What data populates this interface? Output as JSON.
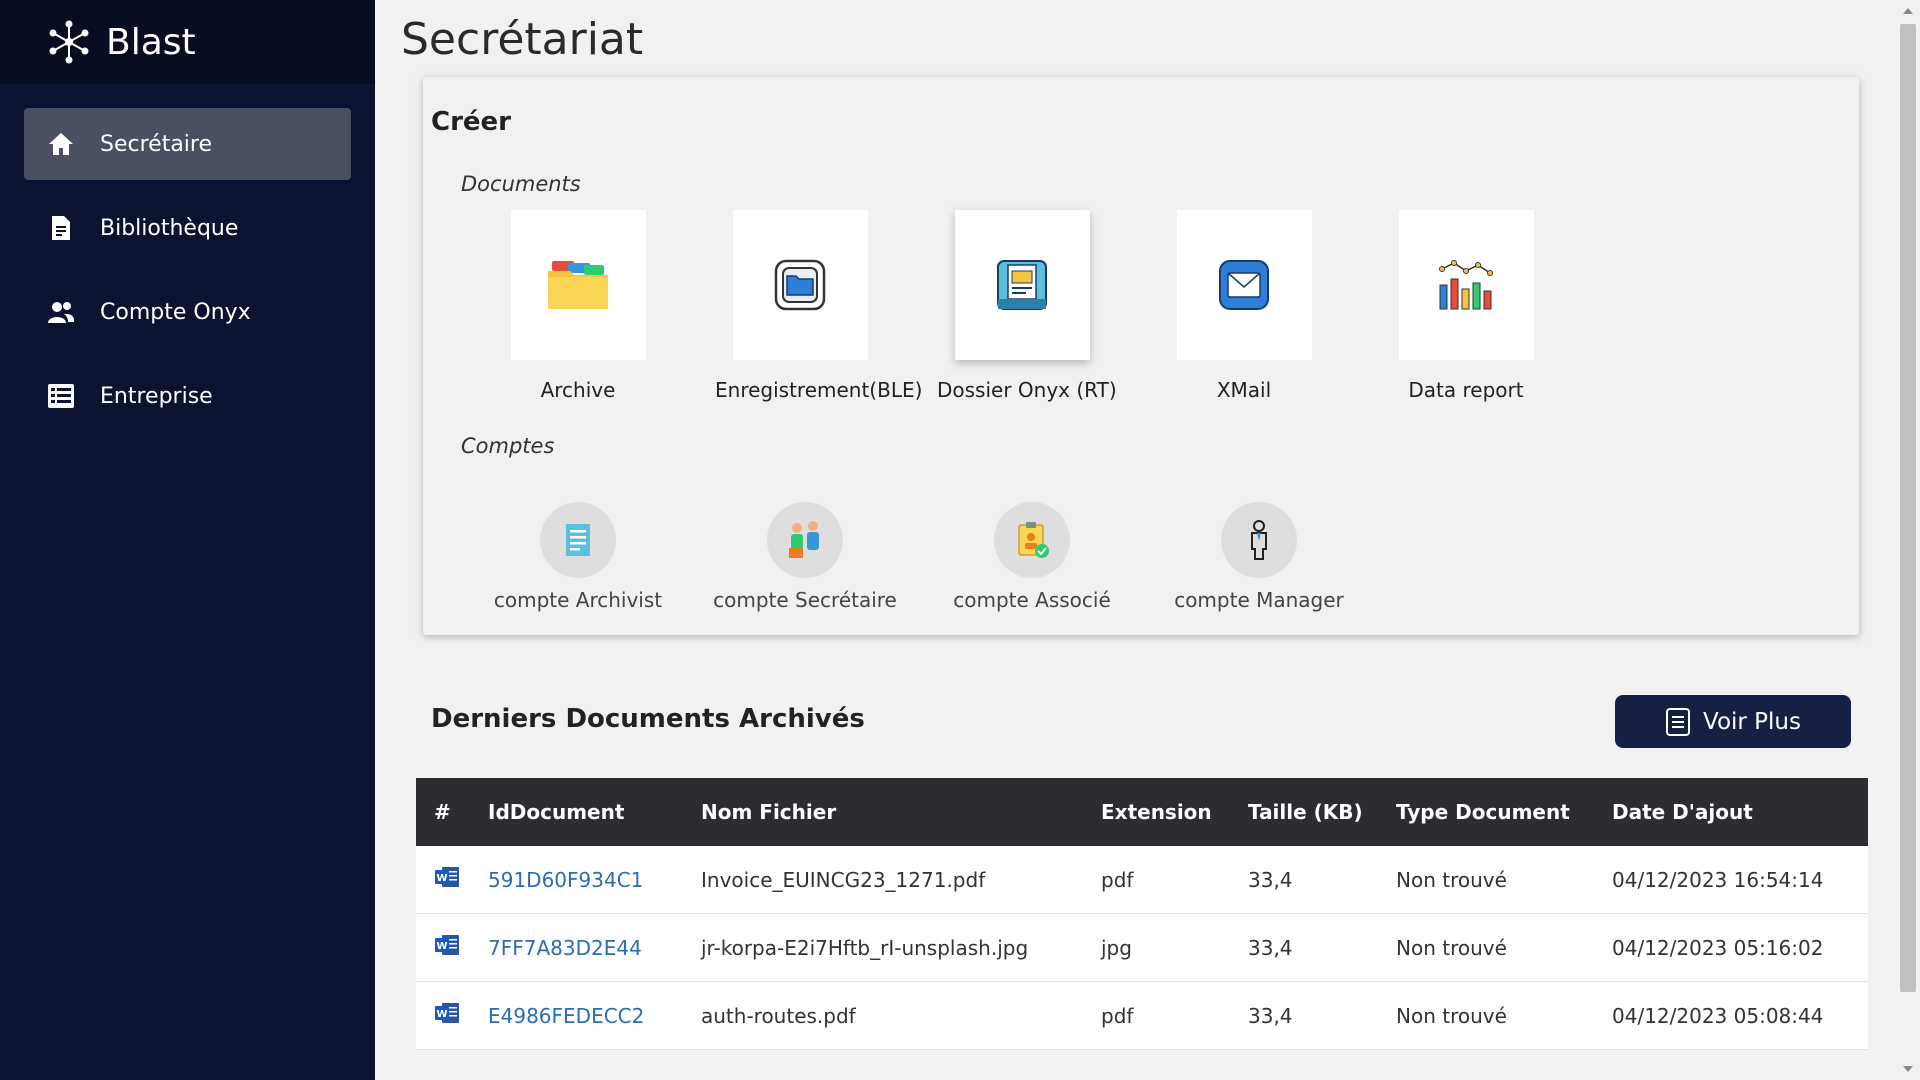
{
  "brand": {
    "name": "Blast",
    "icon": "network-nodes-icon"
  },
  "sidebar": {
    "items": [
      {
        "label": "Secrétaire",
        "icon": "home-icon",
        "active": true
      },
      {
        "label": "Bibliothèque",
        "icon": "document-icon",
        "active": false
      },
      {
        "label": "Compte Onyx",
        "icon": "users-icon",
        "active": false
      },
      {
        "label": "Entreprise",
        "icon": "list-icon",
        "active": false
      }
    ]
  },
  "page": {
    "title": "Secrétariat"
  },
  "create": {
    "title": "Créer",
    "documents_label": "Documents",
    "documents": [
      {
        "label": "Archive",
        "icon": "folder-icon"
      },
      {
        "label": "Enregistrement(BLE)",
        "icon": "folder-app-icon"
      },
      {
        "label": "Dossier Onyx (RT)",
        "icon": "document-scan-icon"
      },
      {
        "label": "XMail",
        "icon": "mail-icon"
      },
      {
        "label": "Data report",
        "icon": "bar-chart-icon"
      }
    ],
    "comptes_label": "Comptes",
    "comptes": [
      {
        "label": "compte Archivist",
        "icon": "notes-icon"
      },
      {
        "label": "compte Secrétaire",
        "icon": "meeting-icon"
      },
      {
        "label": "compte Associé",
        "icon": "clipboard-check-icon"
      },
      {
        "label": "compte Manager",
        "icon": "person-icon"
      }
    ]
  },
  "recent": {
    "title": "Derniers Documents Archivés",
    "voir_plus_label": "Voir Plus",
    "columns": [
      "#",
      "IdDocument",
      "Nom Fichier",
      "Extension",
      "Taille (KB)",
      "Type Document",
      "Date D'ajout"
    ],
    "rows": [
      {
        "id": "591D60F934C1",
        "name": "Invoice_EUINCG23_1271.pdf",
        "ext": "pdf",
        "size": "33,4",
        "type": "Non trouvé",
        "date": "04/12/2023 16:54:14"
      },
      {
        "id": "7FF7A83D2E44",
        "name": "jr-korpa-E2i7Hftb_rI-unsplash.jpg",
        "ext": "jpg",
        "size": "33,4",
        "type": "Non trouvé",
        "date": "04/12/2023 05:16:02"
      },
      {
        "id": "E4986FEDECC2",
        "name": "auth-routes.pdf",
        "ext": "pdf",
        "size": "33,4",
        "type": "Non trouvé",
        "date": "04/12/2023 05:08:44"
      }
    ]
  },
  "colors": {
    "sidebar": "#0b1330",
    "brand_bar": "#070d20",
    "active_item": "#4a5060",
    "button": "#152044",
    "table_header": "#2b2d31",
    "link": "#2a6db5"
  }
}
